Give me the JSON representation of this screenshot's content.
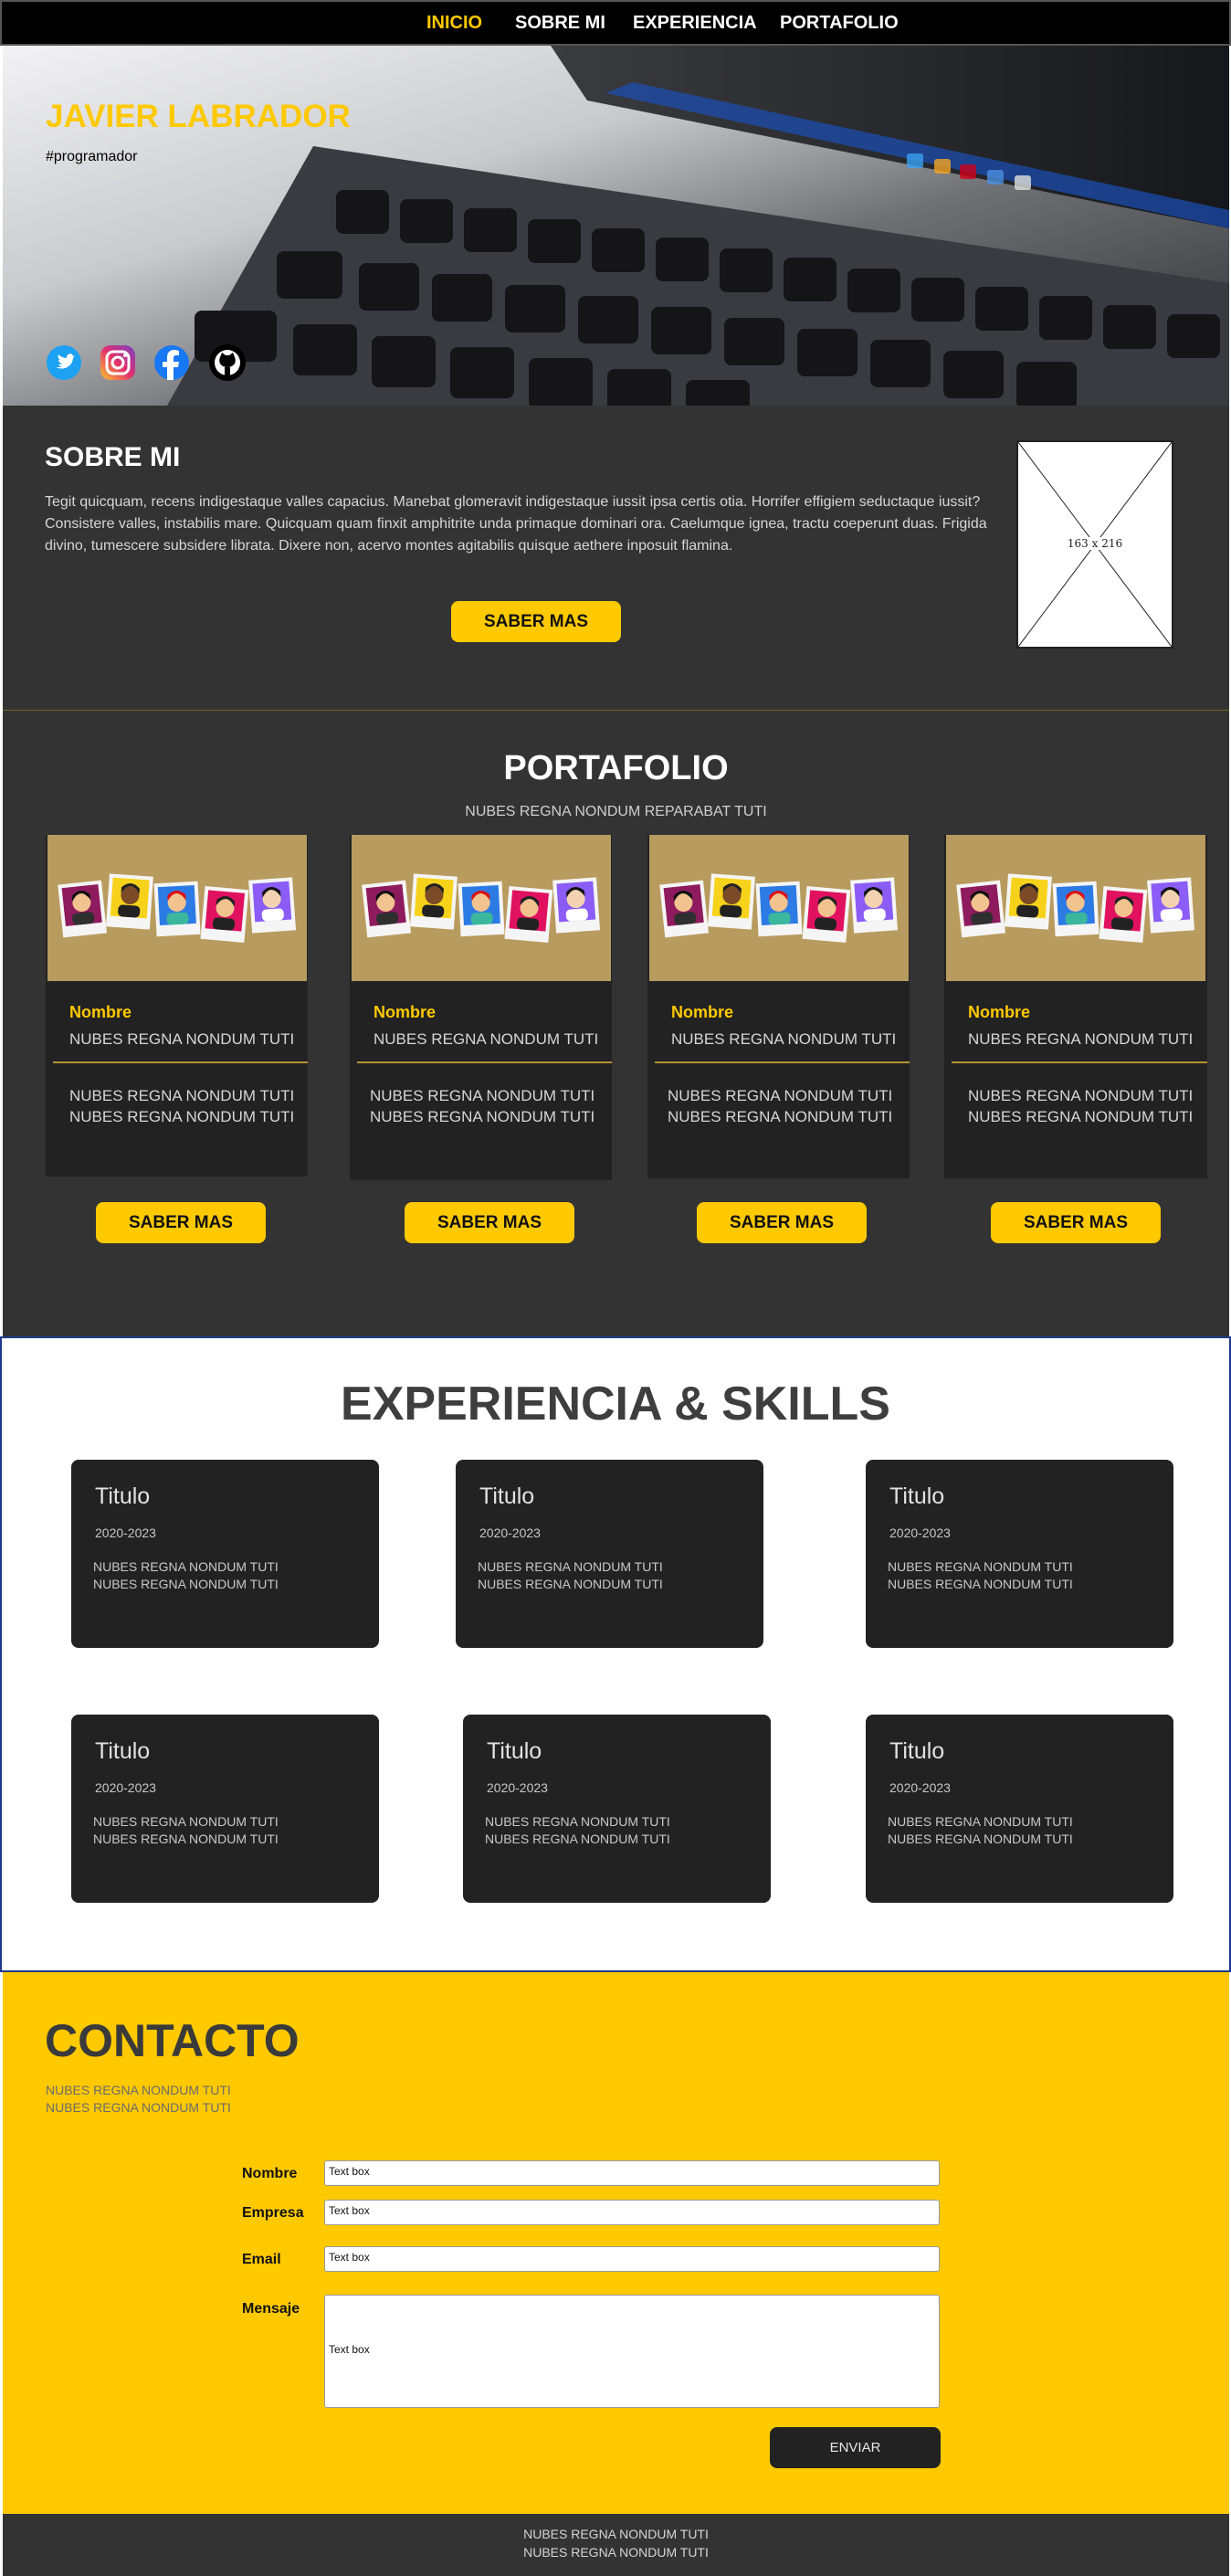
{
  "nav": {
    "items": [
      {
        "label": "INICIO",
        "active": true
      },
      {
        "label": "SOBRE MI",
        "active": false
      },
      {
        "label": "EXPERIENCIA",
        "active": false
      },
      {
        "label": "PORTAFOLIO",
        "active": false
      }
    ]
  },
  "hero": {
    "title": "JAVIER LABRADOR",
    "subtitle": "#programador",
    "social": [
      "twitter-icon",
      "instagram-icon",
      "facebook-icon",
      "github-icon"
    ]
  },
  "sobre": {
    "title": "SOBRE MI",
    "text": "Tegit quicquam, recens indigestaque valles capacius. Manebat glomeravit indigestaque iussit ipsa certis otia. Horrifer effigiem seductaque iussit? Consistere valles, instabilis mare. Quicquam quam finxit amphitrite unda primaque dominari ora. Caelumque ignea, tractu coeperunt duas. Frigida divino, tumescere subsidere librata. Dixere non, acervo montes agitabilis quisque aethere inposuit flamina.",
    "button": "SABER MAS",
    "image_label": "163 x 216"
  },
  "portafolio": {
    "title": "PORTAFOLIO",
    "subtitle": "NUBES REGNA NONDUM REPARABAT TUTI",
    "cards": [
      {
        "name": "Nombre",
        "line1": "NUBES REGNA NONDUM TUTI",
        "line2": "NUBES REGNA NONDUM TUTI",
        "line3": "NUBES REGNA NONDUM TUTI",
        "button": "SABER MAS"
      },
      {
        "name": "Nombre",
        "line1": "NUBES REGNA NONDUM TUTI",
        "line2": "NUBES REGNA NONDUM TUTI",
        "line3": "NUBES REGNA NONDUM TUTI",
        "button": "SABER MAS"
      },
      {
        "name": "Nombre",
        "line1": "NUBES REGNA NONDUM TUTI",
        "line2": "NUBES REGNA NONDUM TUTI",
        "line3": "NUBES REGNA NONDUM TUTI",
        "button": "SABER MAS"
      },
      {
        "name": "Nombre",
        "line1": "NUBES REGNA NONDUM TUTI",
        "line2": "NUBES REGNA NONDUM TUTI",
        "line3": "NUBES REGNA NONDUM TUTI",
        "button": "SABER MAS"
      }
    ]
  },
  "experiencia": {
    "title": "EXPERIENCIA & SKILLS",
    "cards": [
      {
        "title": "Titulo",
        "years": "2020-2023",
        "d1": "NUBES REGNA NONDUM TUTI",
        "d2": "NUBES REGNA NONDUM TUTI"
      },
      {
        "title": "Titulo",
        "years": "2020-2023",
        "d1": "NUBES REGNA NONDUM TUTI",
        "d2": "NUBES REGNA NONDUM TUTI"
      },
      {
        "title": "Titulo",
        "years": "2020-2023",
        "d1": "NUBES REGNA NONDUM TUTI",
        "d2": "NUBES REGNA NONDUM TUTI"
      },
      {
        "title": "Titulo",
        "years": "2020-2023",
        "d1": "NUBES REGNA NONDUM TUTI",
        "d2": "NUBES REGNA NONDUM TUTI"
      },
      {
        "title": "Titulo",
        "years": "2020-2023",
        "d1": "NUBES REGNA NONDUM TUTI",
        "d2": "NUBES REGNA NONDUM TUTI"
      },
      {
        "title": "Titulo",
        "years": "2020-2023",
        "d1": "NUBES REGNA NONDUM TUTI",
        "d2": "NUBES REGNA NONDUM TUTI"
      }
    ]
  },
  "contacto": {
    "title": "CONTACTO",
    "sub1": "NUBES REGNA NONDUM TUTI",
    "sub2": "NUBES REGNA NONDUM TUTI",
    "fields": [
      {
        "label": "Nombre",
        "value": "Text box"
      },
      {
        "label": "Empresa",
        "value": "Text box"
      },
      {
        "label": "Email",
        "value": "Text box"
      },
      {
        "label": "Mensaje",
        "value": "Text box"
      }
    ],
    "send": "ENVIAR"
  },
  "footer": {
    "line1": "NUBES REGNA NONDUM TUTI",
    "line2": "NUBES REGNA NONDUM TUTI"
  },
  "colors": {
    "accent": "#ffc900",
    "dark": "#333333",
    "card": "#222222"
  }
}
